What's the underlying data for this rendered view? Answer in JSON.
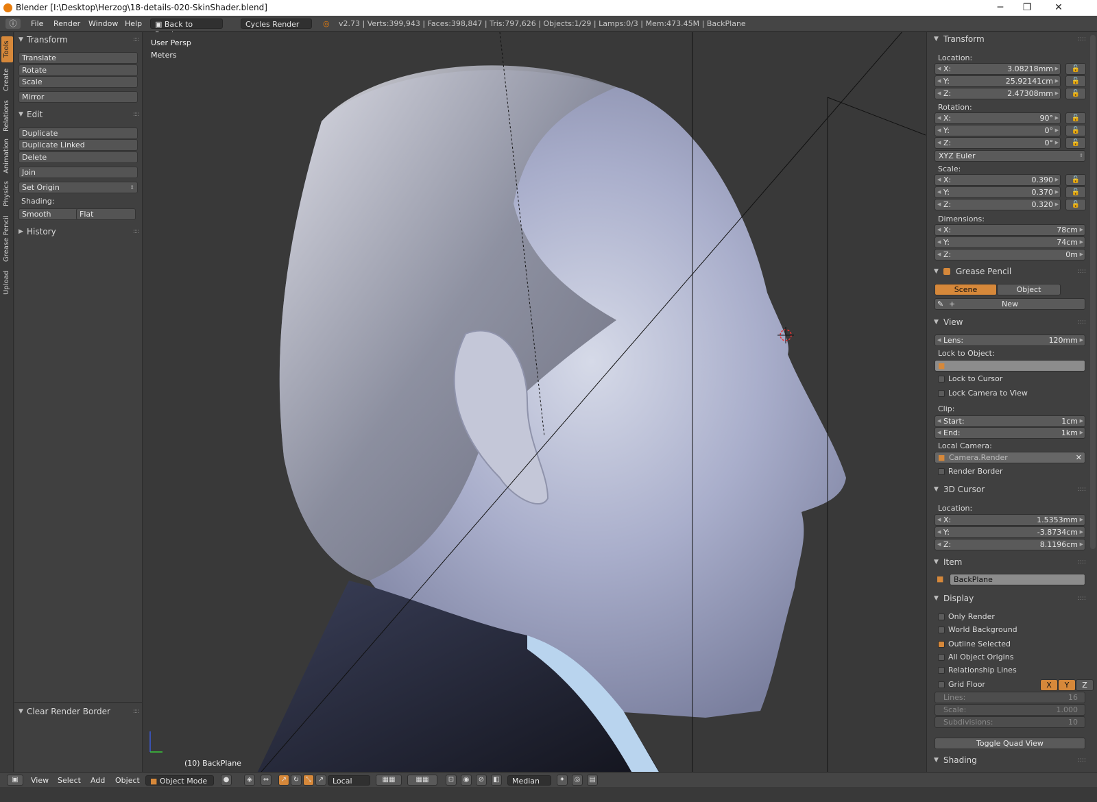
{
  "window": {
    "title": "Blender [I:\\Desktop\\Herzog\\18-details-020-SkinShader.blend]",
    "minimize": "─",
    "maximize": "❐",
    "close": "✕"
  },
  "infobar": {
    "menus": [
      "File",
      "Render",
      "Window",
      "Help"
    ],
    "back_label": "Back to Previous",
    "engine": "Cycles Render",
    "stats": "v2.73 | Verts:399,943 | Faces:398,847 | Tris:797,626 | Objects:1/29 | Lamps:0/3 | Mem:473.45M | BackPlane"
  },
  "tabs": [
    "Tools",
    "Create",
    "Relations",
    "Animation",
    "Physics",
    "Grease Pencil",
    "Upload"
  ],
  "toolshelf": {
    "transform": {
      "title": "Transform",
      "buttons": [
        "Translate",
        "Rotate",
        "Scale",
        "Mirror"
      ]
    },
    "edit": {
      "title": "Edit",
      "buttons": [
        "Duplicate",
        "Duplicate Linked",
        "Delete",
        "Join"
      ],
      "set_origin": "Set Origin",
      "shading_label": "Shading:",
      "smooth": "Smooth",
      "flat": "Flat"
    },
    "history": {
      "title": "History"
    },
    "operator": {
      "title": "Clear Render Border"
    }
  },
  "viewport": {
    "view_name": "User Persp",
    "units": "Meters",
    "object_label": "(10) BackPlane"
  },
  "props": {
    "transform": {
      "title": "Transform",
      "location_label": "Location:",
      "location": [
        {
          "k": "X:",
          "v": "3.08218mm"
        },
        {
          "k": "Y:",
          "v": "25.92141cm"
        },
        {
          "k": "Z:",
          "v": "2.47308mm"
        }
      ],
      "rotation_label": "Rotation:",
      "rotation": [
        {
          "k": "X:",
          "v": "90°"
        },
        {
          "k": "Y:",
          "v": "0°"
        },
        {
          "k": "Z:",
          "v": "0°"
        }
      ],
      "rotation_mode": "XYZ Euler",
      "scale_label": "Scale:",
      "scale": [
        {
          "k": "X:",
          "v": "0.390"
        },
        {
          "k": "Y:",
          "v": "0.370"
        },
        {
          "k": "Z:",
          "v": "0.320"
        }
      ],
      "dimensions_label": "Dimensions:",
      "dimensions": [
        {
          "k": "X:",
          "v": "78cm"
        },
        {
          "k": "Y:",
          "v": "74cm"
        },
        {
          "k": "Z:",
          "v": "0m"
        }
      ]
    },
    "grease_pencil": {
      "title": "Grease Pencil",
      "scene": "Scene",
      "object": "Object",
      "new": "New"
    },
    "view": {
      "title": "View",
      "lens_k": "Lens:",
      "lens_v": "120mm",
      "lock_object_label": "Lock to Object:",
      "lock_cursor": "Lock to Cursor",
      "lock_camera": "Lock Camera to View",
      "clip_label": "Clip:",
      "clip_start_k": "Start:",
      "clip_start_v": "1cm",
      "clip_end_k": "End:",
      "clip_end_v": "1km",
      "local_camera_label": "Local Camera:",
      "local_camera": "Camera.Render",
      "render_border": "Render Border"
    },
    "cursor": {
      "title": "3D Cursor",
      "location_label": "Location:",
      "location": [
        {
          "k": "X:",
          "v": "1.5353mm"
        },
        {
          "k": "Y:",
          "v": "-3.8734cm"
        },
        {
          "k": "Z:",
          "v": "8.1196cm"
        }
      ]
    },
    "item": {
      "title": "Item",
      "name": "BackPlane"
    },
    "display": {
      "title": "Display",
      "only_render": "Only Render",
      "world_background": "World Background",
      "outline_selected": "Outline Selected",
      "all_origins": "All Object Origins",
      "relationship_lines": "Relationship Lines",
      "grid_floor": "Grid Floor",
      "axes": [
        "X",
        "Y",
        "Z"
      ],
      "lines_k": "Lines:",
      "lines_v": "16",
      "scale_k": "Scale:",
      "scale_v": "1.000",
      "subdiv_k": "Subdivisions:",
      "subdiv_v": "10",
      "toggle_quad": "Toggle Quad View"
    },
    "shading": {
      "title": "Shading"
    }
  },
  "bottombar": {
    "menus": [
      "View",
      "Select",
      "Add",
      "Object"
    ],
    "mode": "Object Mode",
    "orientation": "Local",
    "pivot": "Median"
  },
  "colors": {
    "accent": "#d6883a",
    "panel": "#404040",
    "viewport": "#393939"
  }
}
